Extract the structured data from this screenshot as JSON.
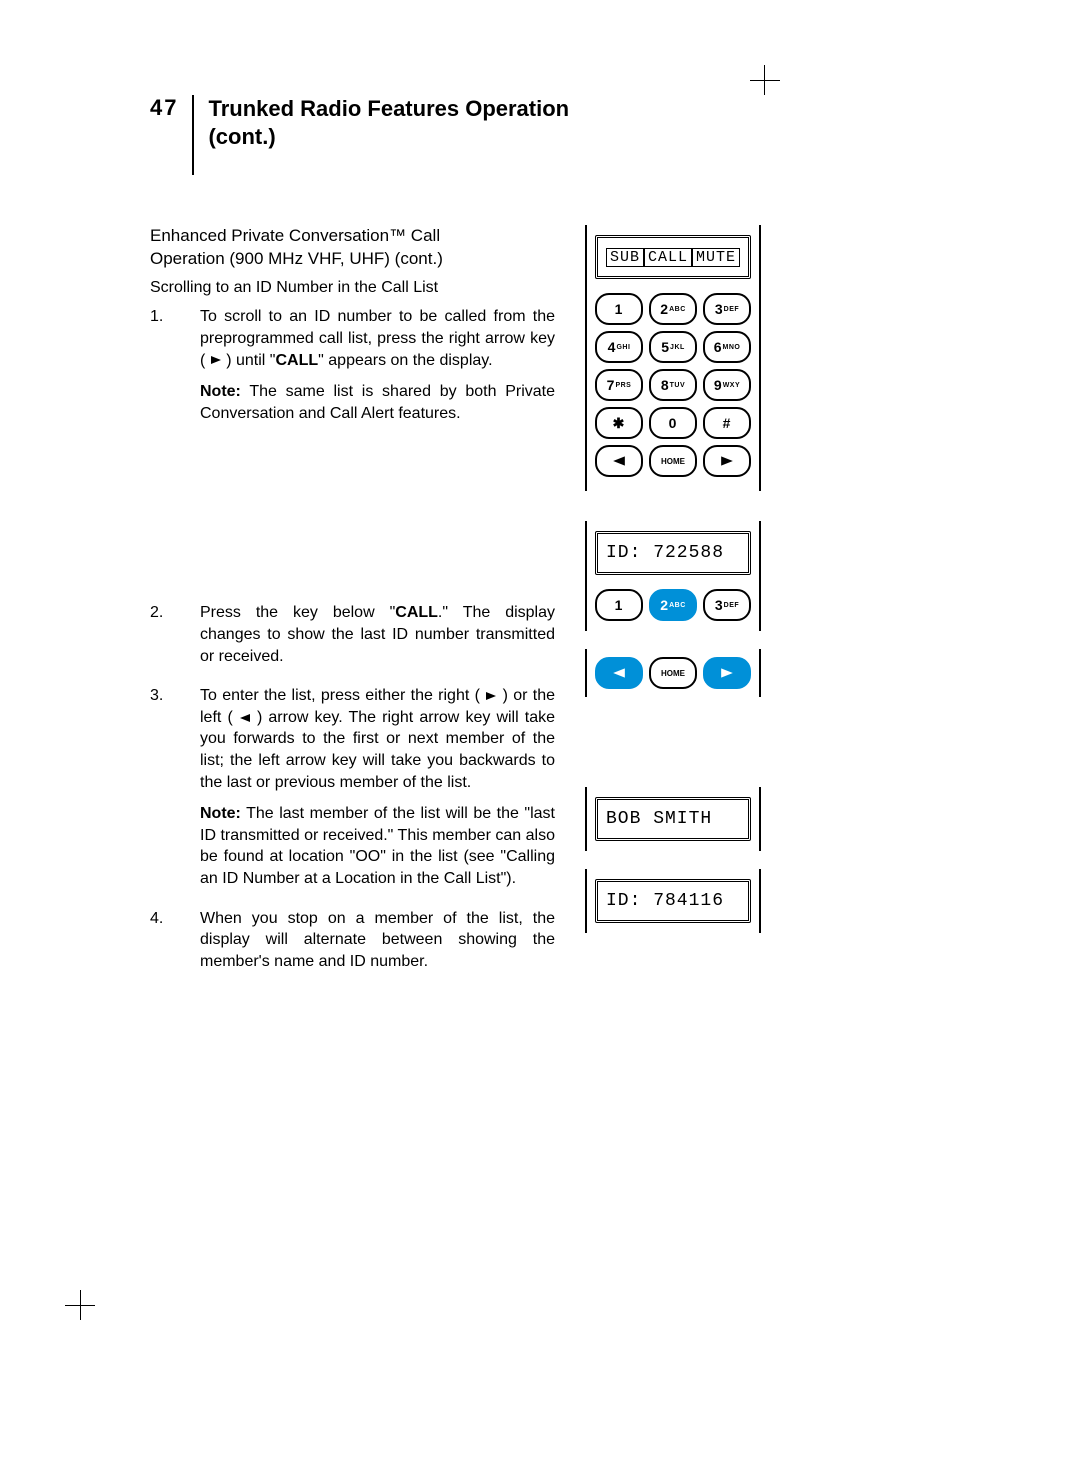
{
  "header": {
    "page_number": "47",
    "title_line1": "Trunked Radio Features Operation",
    "title_line2": "(cont.)"
  },
  "section": {
    "subtitle_line1": "Enhanced Private Conversation™ Call",
    "subtitle_line2": "Operation (900 MHz VHF, UHF) (cont.)",
    "scrolling_heading": "Scrolling to an ID Number in the Call List"
  },
  "steps": {
    "s1_a": "To scroll to an ID number to be called from the preprogrammed call list, press the right arrow key ( ",
    "s1_b": " ) until \"",
    "s1_call": "CALL",
    "s1_c": "\" appears on the display.",
    "s1_note_label": "Note:",
    "s1_note_text": " The same list is shared by both Private Conversation and Call Alert features.",
    "s2_a": "Press the key below \"",
    "s2_call": "CALL",
    "s2_b": ".\" The display changes to show the last ID number transmitted or received.",
    "s3_a": "To enter the list, press either the right ( ",
    "s3_b": " ) or the left ( ",
    "s3_c": " ) arrow key. The right arrow key will take you forwards to the first or next member of the list; the left arrow key will take you backwards to the last or previous member of the list.",
    "s3_note_label": "Note:",
    "s3_note_text": " The last member of the list will be the \"last ID transmitted or received.\" This member can also be found at location \"OO\" in the list (see \"Calling an ID Number at a Location in the Call List\").",
    "s4": "When you stop on a member of the list, the display will alternate between showing the member's name and ID number."
  },
  "displays": {
    "softkeys": {
      "a": "SUB",
      "b": "CALL",
      "c": "MUTE"
    },
    "id1": "ID: 722588",
    "name": "BOB SMITH",
    "id2": "ID: 784116"
  },
  "keys": {
    "k1": "1",
    "k2d": "2",
    "k2l": "ABC",
    "k3d": "3",
    "k3l": "DEF",
    "k4d": "4",
    "k4l": "GHI",
    "k5d": "5",
    "k5l": "JKL",
    "k6d": "6",
    "k6l": "MNO",
    "k7d": "7",
    "k7l": "PRS",
    "k8d": "8",
    "k8l": "TUV",
    "k9d": "9",
    "k9l": "WXY",
    "kst": "✱",
    "k0": "0",
    "kpd": "#",
    "home": "HOME"
  }
}
